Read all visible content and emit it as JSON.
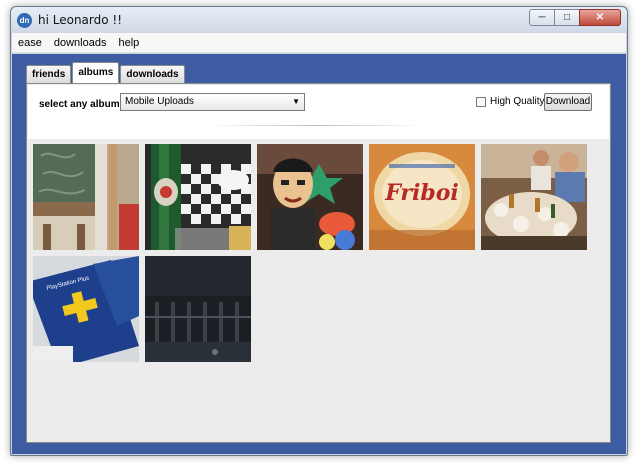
{
  "window": {
    "app_icon_text": "dn",
    "title": "hi Leonardo !!"
  },
  "menu": [
    "ease",
    "downloads",
    "help"
  ],
  "tabs": [
    "friends",
    "albums",
    "downloads"
  ],
  "active_tab": "albums",
  "album_selector": {
    "label": "select any album",
    "selected": "Mobile Uploads"
  },
  "options": {
    "high_quality_label": "High Quality",
    "high_quality_checked": false,
    "download_label": "Download"
  },
  "photos": [
    {
      "description": "chalkboard-and-chair"
    },
    {
      "description": "beer-bottle-checkered-table"
    },
    {
      "description": "cartoon-figure-statue"
    },
    {
      "description": "friboi-logo"
    },
    {
      "description": "restaurant-group-table"
    },
    {
      "description": "playstation-plus-cards"
    },
    {
      "description": "dark-night-building"
    }
  ],
  "photo_texts": {
    "friboi": "Friboi",
    "playstation_plus": "PlayStation Plus"
  },
  "colors": {
    "client_background": "#3e5ca1",
    "panel_background": "#ececec"
  }
}
